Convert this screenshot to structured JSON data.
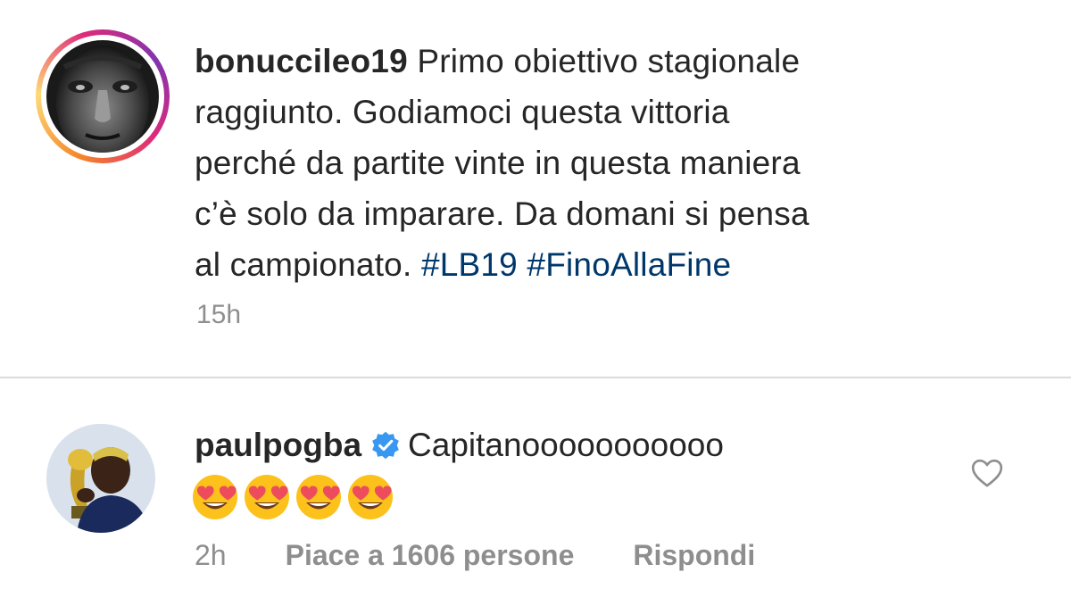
{
  "post": {
    "username": "bonuccileo19",
    "caption_lines": [
      "Primo obiettivo stagionale",
      "raggiunto. Godiamoci questa vittoria",
      "perché da partite vinte in questa maniera",
      "c’è solo da imparare. Da domani si pensa",
      "al campionato."
    ],
    "hashtags": [
      "#LB19",
      "#FinoAllaFine"
    ],
    "time": "15h",
    "has_story_ring": true
  },
  "comment": {
    "username": "paulpogba",
    "verified": true,
    "text": "Capitanooooooooooo",
    "emojis": [
      "smiling-face-with-heart-eyes",
      "smiling-face-with-heart-eyes",
      "smiling-face-with-heart-eyes",
      "smiling-face-with-heart-eyes"
    ],
    "time": "2h",
    "likes_label": "Piace a 1606 persone",
    "reply_label": "Rispondi"
  },
  "colors": {
    "text": "#262626",
    "secondary_text": "#8e8e8e",
    "hashtag": "#00376b",
    "verified": "#3897f0",
    "divider": "#dbdbdb"
  }
}
